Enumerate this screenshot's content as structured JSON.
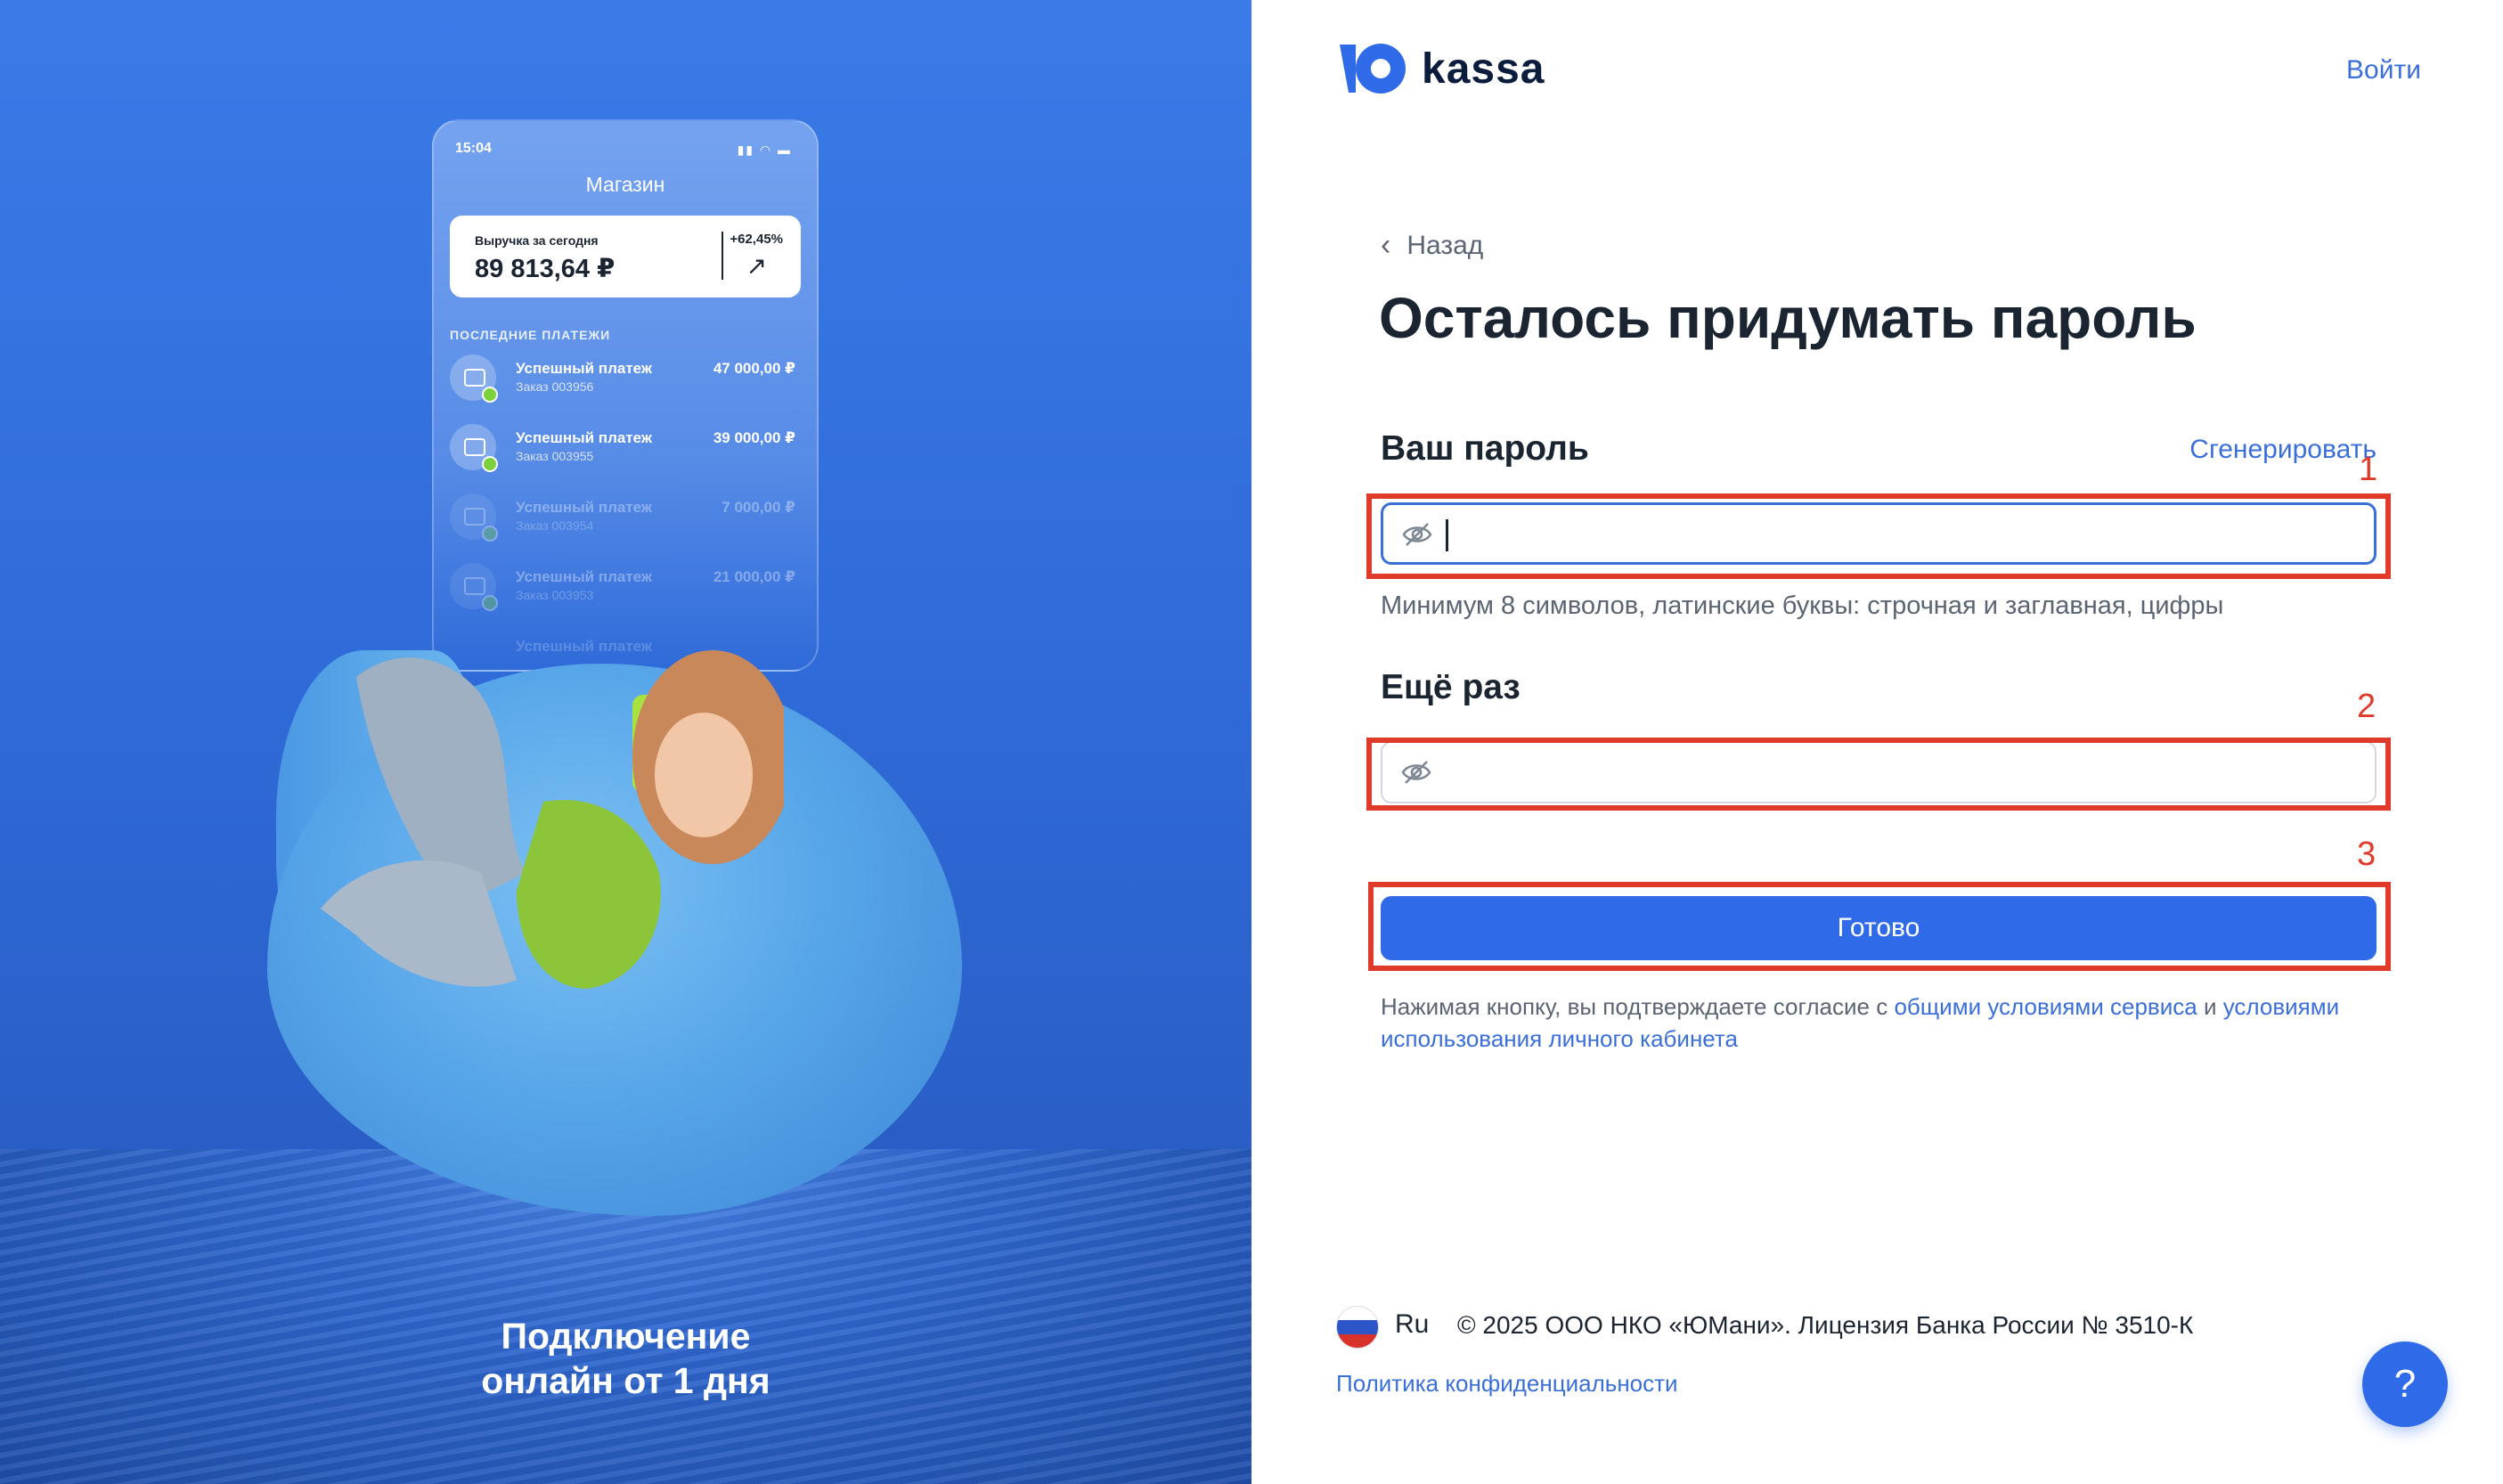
{
  "promo": {
    "phone": {
      "time": "15:04",
      "shop_title": "Магазин",
      "revenue_label": "Выручка за сегодня",
      "revenue_amount": "89 813,64 ₽",
      "revenue_change": "+62,45%",
      "payments_title": "ПОСЛЕДНИЕ ПЛАТЕЖИ",
      "payments": [
        {
          "name": "Успешный платеж",
          "order": "Заказ 003956",
          "sum": "47 000,00 ₽"
        },
        {
          "name": "Успешный платеж",
          "order": "Заказ 003955",
          "sum": "39 000,00 ₽"
        },
        {
          "name": "Успешный платеж",
          "order": "Заказ 003954",
          "sum": "7 000,00 ₽"
        },
        {
          "name": "Успешный платеж",
          "order": "Заказ 003953",
          "sum": "21 000,00 ₽"
        },
        {
          "name": "Успешный платеж",
          "order": "",
          "sum": ""
        }
      ]
    },
    "caption_line1": "Подключение",
    "caption_line2": "онлайн от 1 дня"
  },
  "header": {
    "logo_text": "kassa",
    "login_label": "Войти"
  },
  "form": {
    "back_label": "Назад",
    "title": "Осталось придумать пароль",
    "password_label": "Ваш пароль",
    "generate_label": "Сгенерировать",
    "password_value": "",
    "password_hint": "Минимум 8 символов, латинские буквы: строчная и заглавная, цифры",
    "repeat_label": "Ещё раз",
    "repeat_value": "",
    "submit_label": "Готово",
    "consent_prefix": "Нажимая кнопку, вы подтверждаете согласие с ",
    "consent_link1": "общими условиями сервиса",
    "consent_middle": " и ",
    "consent_link2": "условиями использования личного кабинета"
  },
  "annotations": [
    "1",
    "2",
    "3"
  ],
  "footer": {
    "lang": "Ru",
    "copyright": "© 2025 ООО НКО «ЮМани». Лицензия Банка России № 3510-К",
    "privacy_label": "Политика конфиденциальности",
    "help_label": "?"
  },
  "colors": {
    "accent": "#2f6be8",
    "link": "#3a6fd8",
    "annotation": "#e03b2a",
    "promo_bg": "#3a7be8"
  }
}
